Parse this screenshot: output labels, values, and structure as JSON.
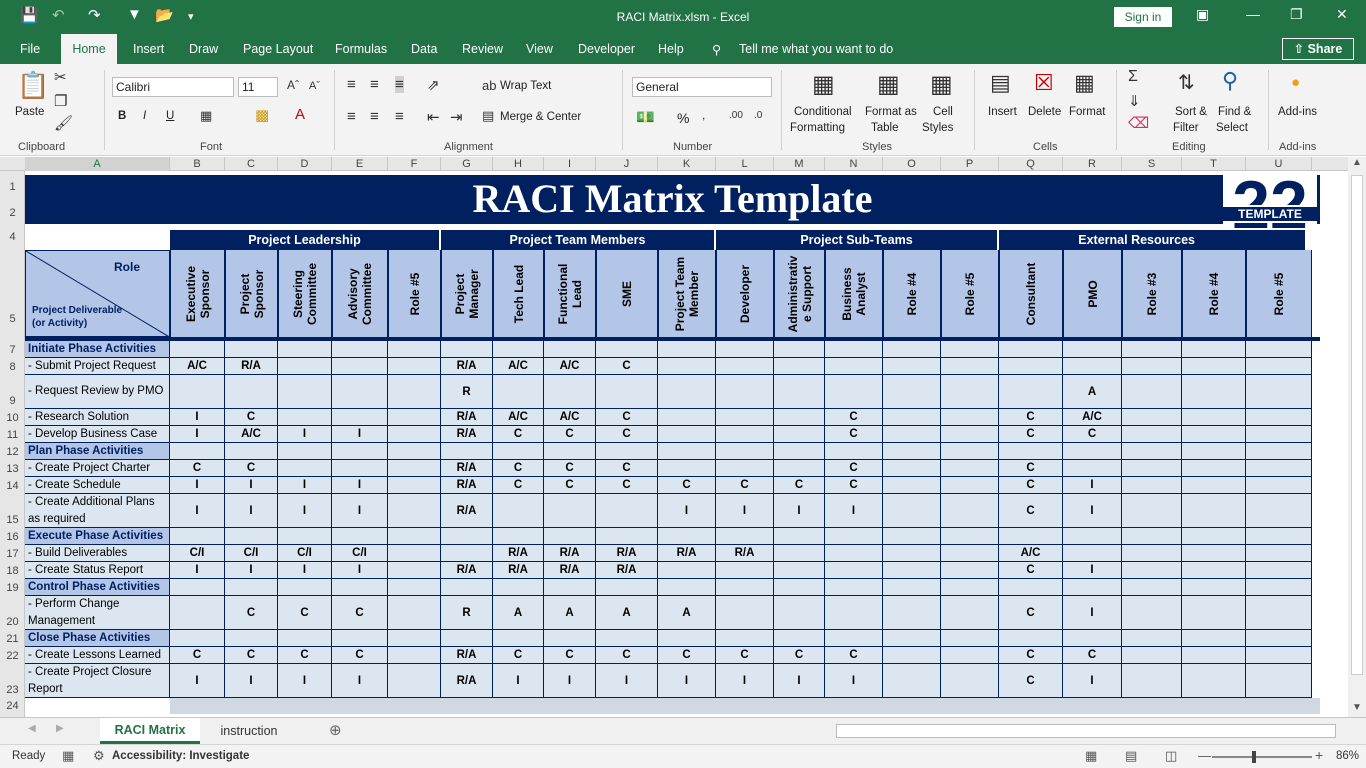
{
  "window": {
    "title": "RACI Matrix.xlsm  -  Excel",
    "sign_in": "Sign in"
  },
  "tabs": [
    "File",
    "Home",
    "Insert",
    "Draw",
    "Page Layout",
    "Formulas",
    "Data",
    "Review",
    "View",
    "Developer",
    "Help"
  ],
  "tell_me": "Tell me what you want to do",
  "share": "Share",
  "ribbon": {
    "clipboard": {
      "paste": "Paste",
      "label": "Clipboard"
    },
    "font": {
      "name": "Calibri",
      "size": "11",
      "label": "Font",
      "bold": "B",
      "italic": "I",
      "underline": "U"
    },
    "alignment": {
      "wrap": "Wrap Text",
      "merge": "Merge & Center",
      "label": "Alignment"
    },
    "number": {
      "format": "General",
      "label": "Number",
      "percent": "%"
    },
    "styles": {
      "conditional": "Conditional",
      "conditional2": "Formatting",
      "format_as": "Format as",
      "format_as2": "Table",
      "cell": "Cell",
      "cell2": "Styles",
      "label": "Styles"
    },
    "cells": {
      "insert": "Insert",
      "delete": "Delete",
      "format": "Format",
      "label": "Cells"
    },
    "editing": {
      "sort": "Sort &",
      "sort2": "Filter",
      "find": "Find &",
      "find2": "Select",
      "label": "Editing"
    },
    "addins": {
      "addins": "Add-ins",
      "label": "Add-ins"
    }
  },
  "columns": [
    "A",
    "B",
    "C",
    "D",
    "E",
    "F",
    "G",
    "H",
    "I",
    "J",
    "K",
    "L",
    "M",
    "N",
    "O",
    "P",
    "Q",
    "R",
    "S",
    "T",
    "U"
  ],
  "rows": [
    "1",
    "2",
    "4",
    "5",
    "7",
    "8",
    "9",
    "10",
    "11",
    "12",
    "13",
    "14",
    "15",
    "16",
    "17",
    "18",
    "19",
    "20",
    "21",
    "22",
    "23",
    "24"
  ],
  "sheet": {
    "title": "RACI Matrix Template",
    "logo_num": "22",
    "logo_text": "TEMPLATE",
    "corner_role": "Role",
    "corner_deliverable": "Project Deliverable\n(or Activity)",
    "groups": [
      "Project Leadership",
      "Project Team Members",
      "Project Sub-Teams",
      "External Resources"
    ],
    "roles": [
      "Executive\nSponsor",
      "Project\nSponsor",
      "Steering\nCommittee",
      "Advisory\nCommittee",
      "Role #5",
      "Project\nManager",
      "Tech Lead",
      "Functional\nLead",
      "SME",
      "Project Team\nMember",
      "Developer",
      "Administrativ\ne Support",
      "Business\nAnalyst",
      "Role #4",
      "Role #5",
      "Consultant",
      "PMO",
      "Role #3",
      "Role #4",
      "Role #5"
    ],
    "activities": [
      {
        "label": "Initiate Phase Activities",
        "phase": true,
        "cells": []
      },
      {
        "label": " - Submit Project Request",
        "cells": [
          "A/C",
          "R/A",
          "",
          "",
          "",
          "R/A",
          "A/C",
          "A/C",
          "C",
          "",
          "",
          "",
          "",
          "",
          "",
          "",
          "",
          "",
          "",
          ""
        ]
      },
      {
        "label": " - Request Review by PMO",
        "cells": [
          "",
          "",
          "",
          "",
          "",
          "R",
          "",
          "",
          "",
          "",
          "",
          "",
          "",
          "",
          "",
          "",
          "A",
          "",
          "",
          ""
        ]
      },
      {
        "label": " - Research Solution",
        "cells": [
          "I",
          "C",
          "",
          "",
          "",
          "R/A",
          "A/C",
          "A/C",
          "C",
          "",
          "",
          "",
          "C",
          "",
          "",
          "C",
          "A/C",
          "",
          "",
          ""
        ]
      },
      {
        "label": " - Develop Business Case",
        "cells": [
          "I",
          "A/C",
          "I",
          "I",
          "",
          "R/A",
          "C",
          "C",
          "C",
          "",
          "",
          "",
          "C",
          "",
          "",
          "C",
          "C",
          "",
          "",
          ""
        ]
      },
      {
        "label": "Plan Phase Activities",
        "phase": true,
        "cells": []
      },
      {
        "label": " - Create Project Charter",
        "cells": [
          "C",
          "C",
          "",
          "",
          "",
          "R/A",
          "C",
          "C",
          "C",
          "",
          "",
          "",
          "C",
          "",
          "",
          "C",
          "",
          "",
          "",
          ""
        ]
      },
      {
        "label": " - Create Schedule",
        "cells": [
          "I",
          "I",
          "I",
          "I",
          "",
          "R/A",
          "C",
          "C",
          "C",
          "C",
          "C",
          "C",
          "C",
          "",
          "",
          "C",
          "I",
          "",
          "",
          ""
        ]
      },
      {
        "label": " - Create Additional Plans as required",
        "cells": [
          "I",
          "I",
          "I",
          "I",
          "",
          "R/A",
          "",
          "",
          "",
          "I",
          "I",
          "I",
          "I",
          "",
          "",
          "C",
          "I",
          "",
          "",
          ""
        ]
      },
      {
        "label": "Execute Phase Activities",
        "phase": true,
        "cells": []
      },
      {
        "label": " - Build Deliverables",
        "cells": [
          "C/I",
          "C/I",
          "C/I",
          "C/I",
          "",
          "",
          "R/A",
          "R/A",
          "R/A",
          "R/A",
          "R/A",
          "",
          "",
          "",
          "",
          "A/C",
          "",
          "",
          "",
          ""
        ]
      },
      {
        "label": " - Create Status Report",
        "cells": [
          "I",
          "I",
          "I",
          "I",
          "",
          "R/A",
          "R/A",
          "R/A",
          "R/A",
          "",
          "",
          "",
          "",
          "",
          "",
          "C",
          "I",
          "",
          "",
          ""
        ]
      },
      {
        "label": "Control Phase Activities",
        "phase": true,
        "cells": []
      },
      {
        "label": " - Perform Change Management",
        "cells": [
          "",
          "C",
          "C",
          "C",
          "",
          "R",
          "A",
          "A",
          "A",
          "A",
          "",
          "",
          "",
          "",
          "",
          "C",
          "I",
          "",
          "",
          ""
        ]
      },
      {
        "label": "Close Phase Activities",
        "phase": true,
        "cells": []
      },
      {
        "label": " - Create Lessons Learned",
        "cells": [
          "C",
          "C",
          "C",
          "C",
          "",
          "R/A",
          "C",
          "C",
          "C",
          "C",
          "C",
          "C",
          "C",
          "",
          "",
          "C",
          "C",
          "",
          "",
          ""
        ]
      },
      {
        "label": " - Create Project Closure Report",
        "cells": [
          "I",
          "I",
          "I",
          "I",
          "",
          "R/A",
          "I",
          "I",
          "I",
          "I",
          "I",
          "I",
          "I",
          "",
          "",
          "C",
          "I",
          "",
          "",
          ""
        ]
      }
    ]
  },
  "sheet_tabs": [
    "RACI Matrix",
    "instruction"
  ],
  "status": {
    "ready": "Ready",
    "accessibility": "Accessibility: Investigate",
    "zoom": "86%"
  }
}
